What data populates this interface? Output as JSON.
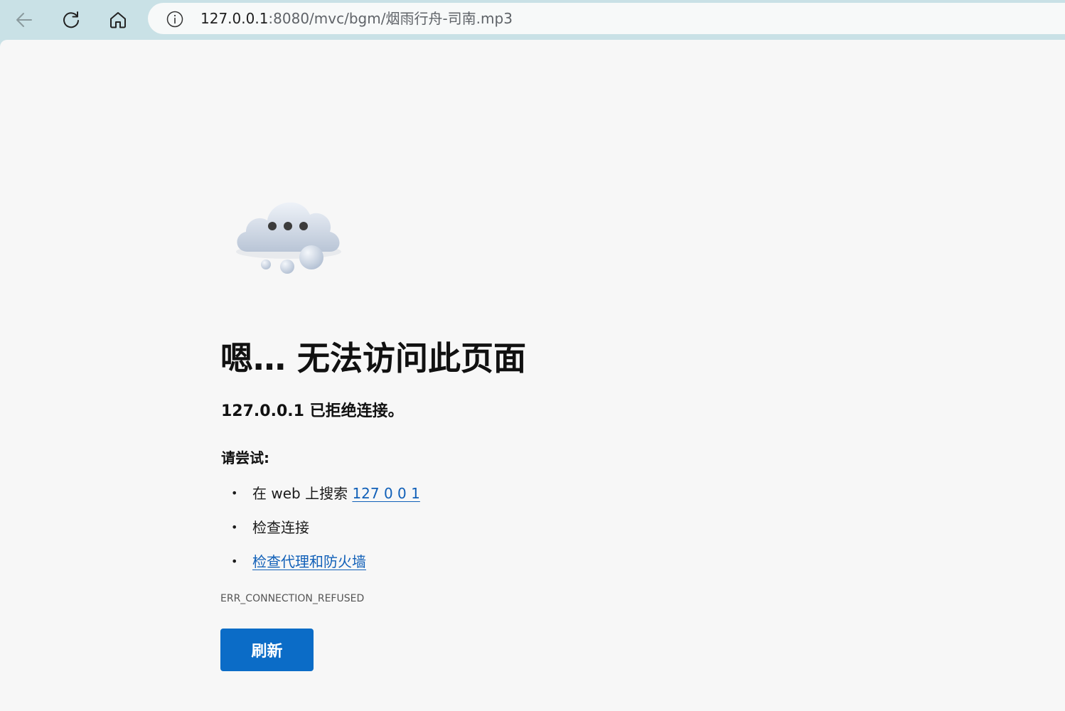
{
  "browser": {
    "back_icon": "arrow-left-icon",
    "reload_icon": "reload-icon",
    "home_icon": "home-icon",
    "info_icon": "info-circle-icon",
    "url_host": "127.0.0.1",
    "url_rest": ":8080/mvc/bgm/烟雨行舟-司南.mp3"
  },
  "page": {
    "illustration_icon": "thinking-cloud-icon",
    "title": "嗯… 无法访问此页面",
    "subtitle": "127.0.0.1 已拒绝连接。",
    "try_label": "请尝试:",
    "suggestions": [
      {
        "prefix": "在 web 上搜索 ",
        "link": "127 0 0 1"
      },
      {
        "prefix": "检查连接",
        "link": ""
      },
      {
        "prefix": "",
        "link": "检查代理和防火墙"
      }
    ],
    "error_code": "ERR_CONNECTION_REFUSED",
    "refresh_label": "刷新",
    "accent_color": "#0b6cc7",
    "link_color": "#1160b8"
  }
}
